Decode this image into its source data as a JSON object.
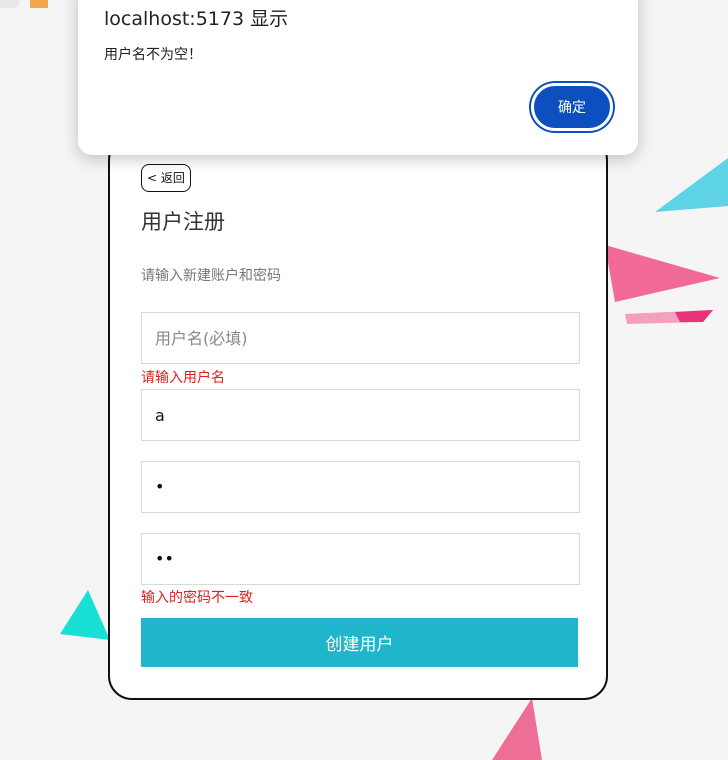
{
  "dialog": {
    "title": "localhost:5173 显示",
    "message": "用户名不为空！",
    "ok_label": "确定"
  },
  "register": {
    "back_label": "< 返回",
    "title": "用户注册",
    "subtitle": "请输入新建账户和密码",
    "username_placeholder": "用户名(必填)",
    "username_error": "请输入用户名",
    "nickname_value": "a",
    "password_value": "•",
    "confirm_value": "••",
    "password_error": "输入的密码不一致",
    "submit_label": "创建用户"
  },
  "colors": {
    "accent": "#1fb6cb",
    "error": "#e02020",
    "dialog_button": "#0d4fbf"
  }
}
